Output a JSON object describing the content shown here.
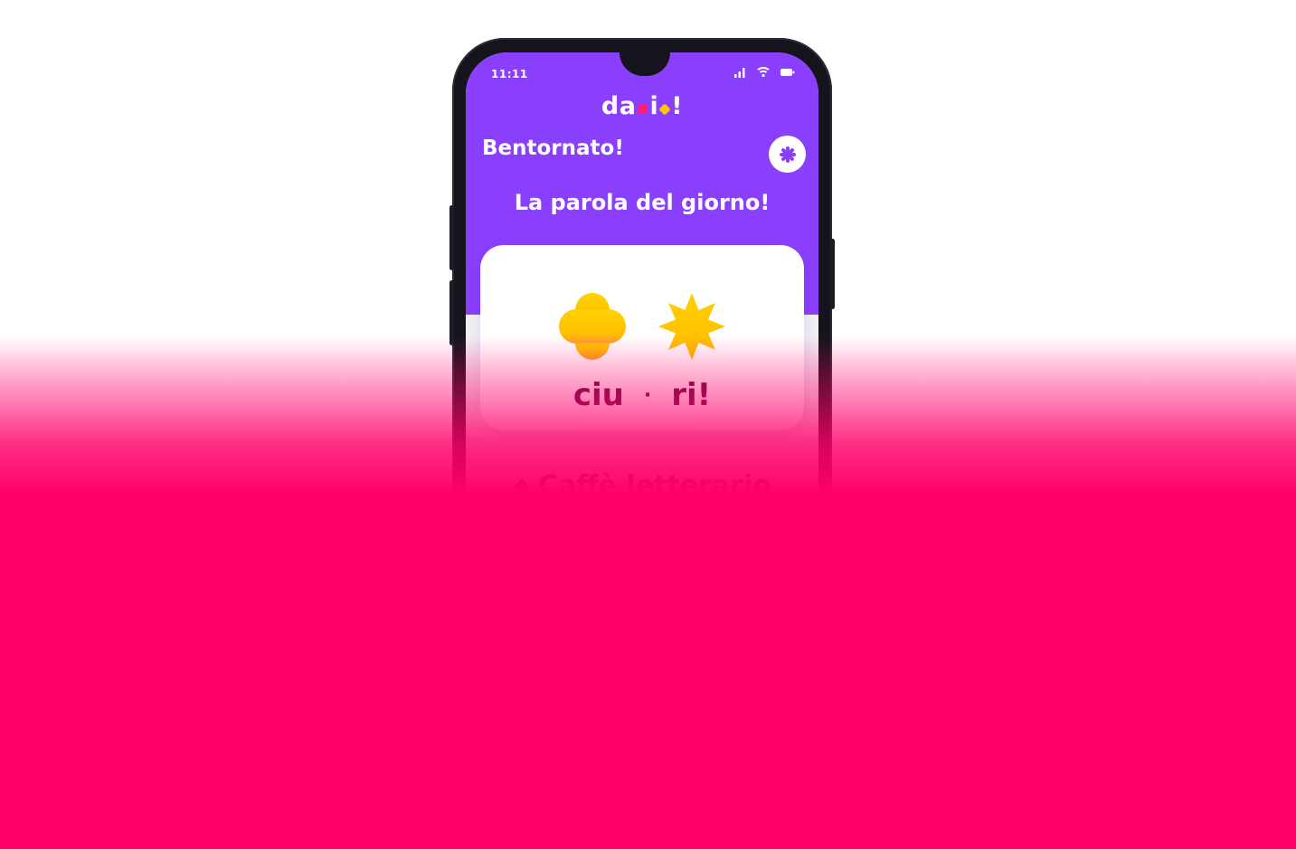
{
  "status_bar": {
    "time": "11:11"
  },
  "app": {
    "logo_parts": [
      "da",
      "i",
      "!"
    ]
  },
  "header": {
    "greeting": "Bentornato!"
  },
  "word_of_day": {
    "heading": "La parola del giorno!",
    "syllables": [
      "ciu",
      "ri!"
    ],
    "separator": "·",
    "icons": [
      "clover-icon",
      "star-burst-icon"
    ]
  },
  "next_section": {
    "title": "Caffè letterario"
  },
  "colors": {
    "primary_purple": "#8a3ffc",
    "accent_pink": "#ff006a",
    "accent_yellow": "#ffc800",
    "word_text": "#5a0f3e"
  }
}
